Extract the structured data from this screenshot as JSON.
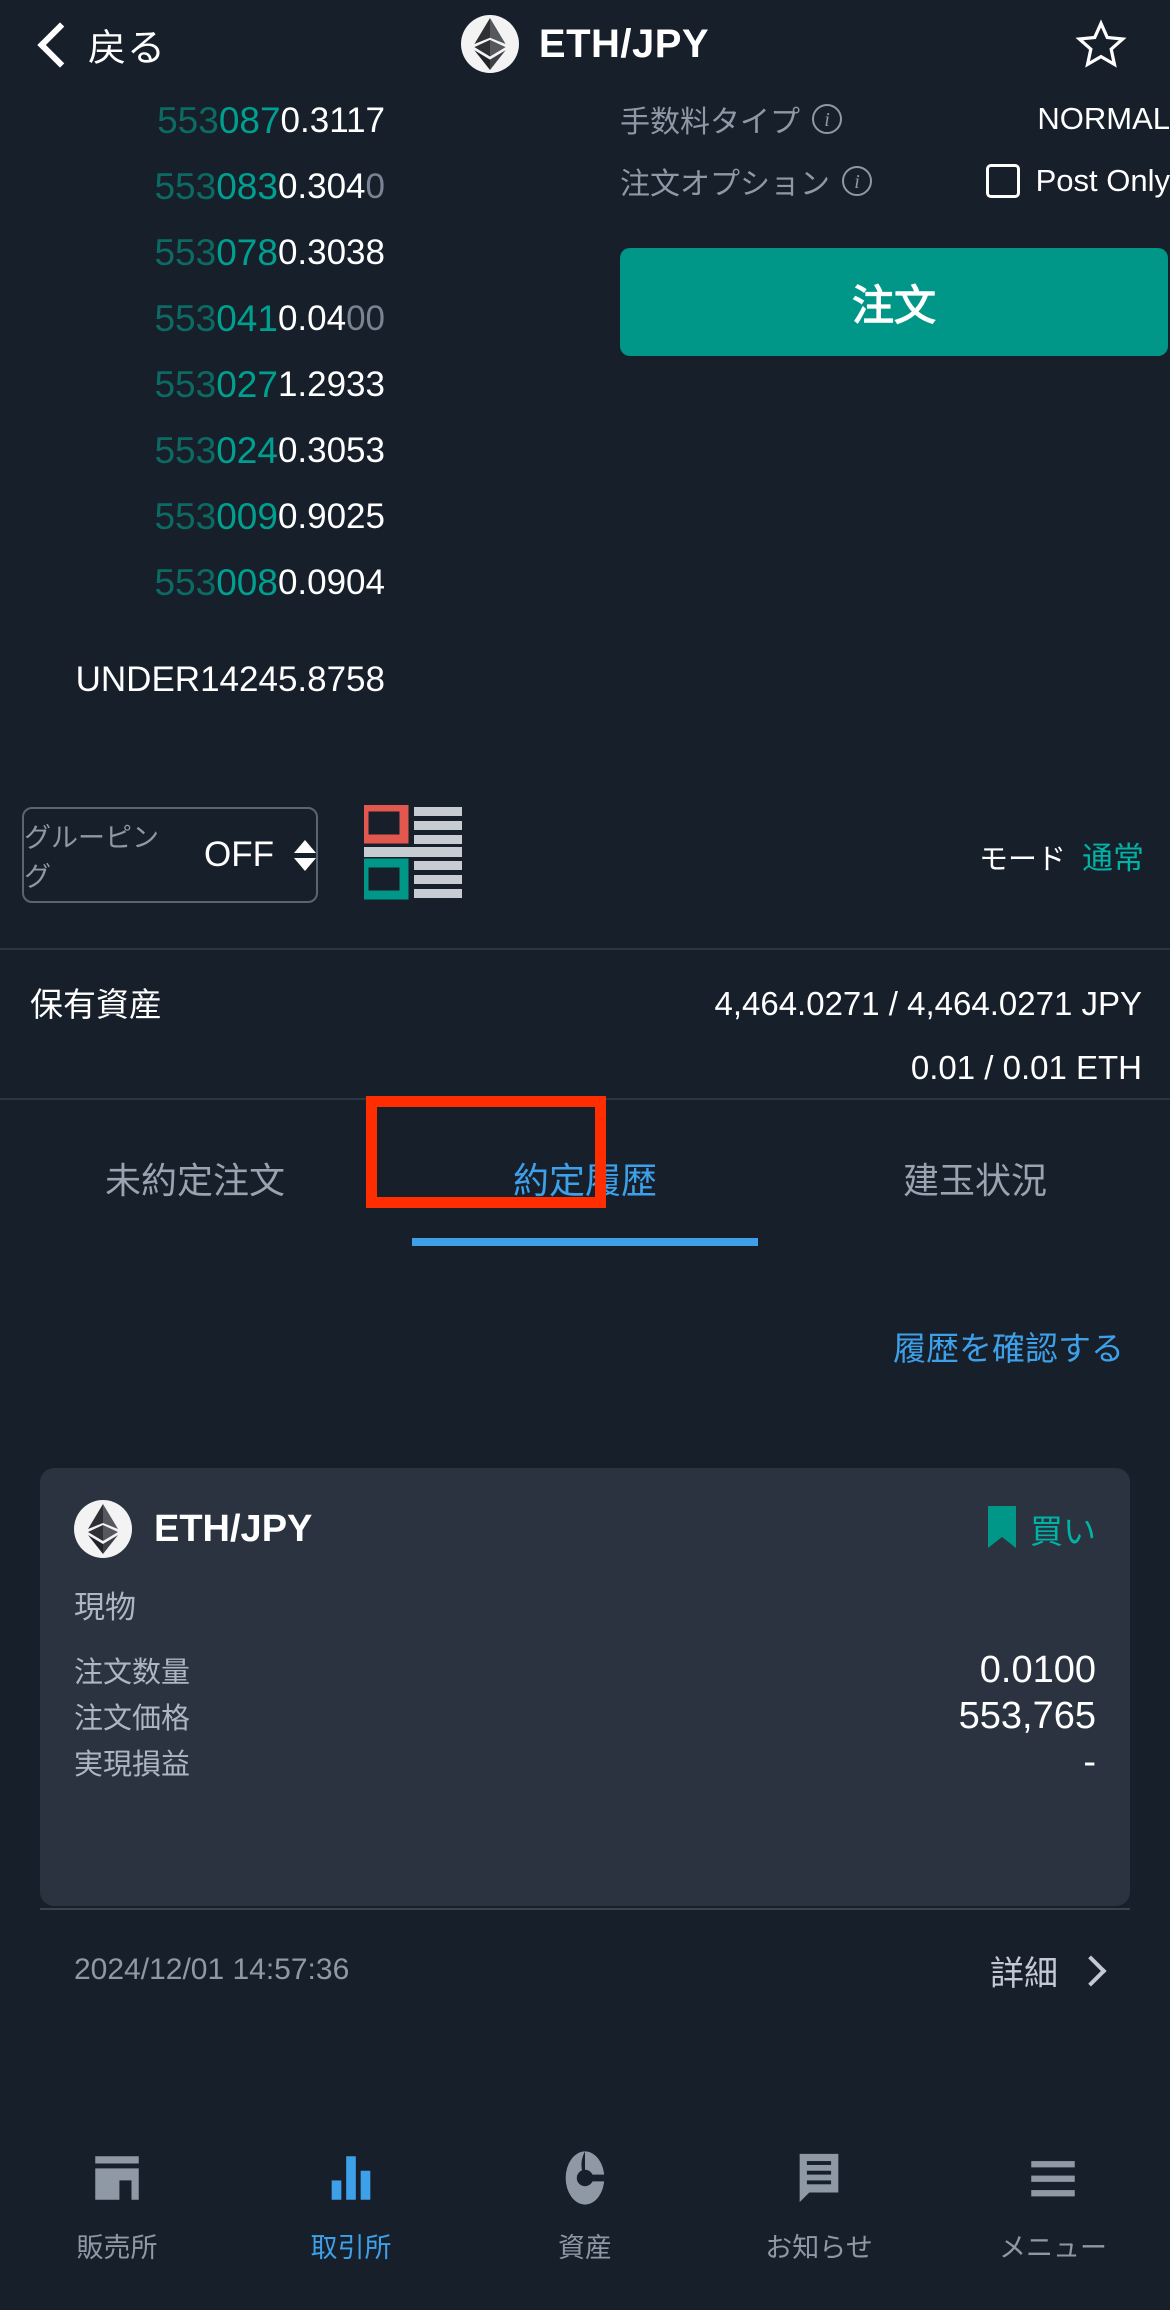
{
  "header": {
    "back_label": "戻る",
    "pair_title": "ETH/JPY",
    "back_icon": "chevron-left-icon",
    "star_icon": "star-outline-icon",
    "coin_icon": "ethereum-icon"
  },
  "orderbook": {
    "rows": [
      {
        "price_dim": "553",
        "price_bright": "087",
        "qty": "0.3117",
        "qty_faded": ""
      },
      {
        "price_dim": "553",
        "price_bright": "083",
        "qty": "0.304",
        "qty_faded": "0"
      },
      {
        "price_dim": "553",
        "price_bright": "078",
        "qty": "0.3038",
        "qty_faded": ""
      },
      {
        "price_dim": "553",
        "price_bright": "041",
        "qty": "0.04",
        "qty_faded": "00"
      },
      {
        "price_dim": "553",
        "price_bright": "027",
        "qty": "1.2933",
        "qty_faded": ""
      },
      {
        "price_dim": "553",
        "price_bright": "024",
        "qty": "0.3053",
        "qty_faded": ""
      },
      {
        "price_dim": "553",
        "price_bright": "009",
        "qty": "0.9025",
        "qty_faded": ""
      },
      {
        "price_dim": "553",
        "price_bright": "008",
        "qty": "0.0904",
        "qty_faded": ""
      }
    ],
    "under_label": "UNDER",
    "under_value": "14245.8758"
  },
  "order_panel": {
    "fee_type_label": "手数料タイプ",
    "fee_type_value": "NORMAL",
    "order_option_label": "注文オプション",
    "post_only_label": "Post Only",
    "post_only_checked": false,
    "submit_label": "注文"
  },
  "grouping": {
    "label": "グルーピング",
    "value": "OFF",
    "spinner_icon": "updown-arrows-icon",
    "depth_icon": "orderbook-layout-icon",
    "mode_label": "モード",
    "mode_value": "通常"
  },
  "assets": {
    "label": "保有資産",
    "lines": [
      "4,464.0271 / 4,464.0271  JPY",
      "0.01 / 0.01  ETH"
    ]
  },
  "tabs": {
    "items": [
      {
        "label": "未約定注文",
        "active": false
      },
      {
        "label": "約定履歴",
        "active": true
      },
      {
        "label": "建玉状況",
        "active": false
      }
    ],
    "highlight_color": "#ff2d00"
  },
  "history": {
    "link_label": "履歴を確認する",
    "card": {
      "pair": "ETH/JPY",
      "side_label": "買い",
      "side_icon": "bookmark-icon",
      "type_label": "現物",
      "rows": [
        {
          "label": "注文数量",
          "value": "0.0100"
        },
        {
          "label": "注文価格",
          "value": "553,765"
        },
        {
          "label": "実現損益",
          "value": "-"
        }
      ],
      "timestamp": "2024/12/01 14:57:36",
      "detail_label": "詳細",
      "detail_icon": "chevron-right-icon"
    }
  },
  "bottom_nav": {
    "items": [
      {
        "label": "販売所",
        "icon": "storefront-icon",
        "active": false
      },
      {
        "label": "取引所",
        "icon": "bar-chart-icon",
        "active": true
      },
      {
        "label": "資産",
        "icon": "pie-chart-icon",
        "active": false
      },
      {
        "label": "お知らせ",
        "icon": "notification-message-icon",
        "active": false
      },
      {
        "label": "メニュー",
        "icon": "hamburger-menu-icon",
        "active": false
      }
    ]
  },
  "colors": {
    "background": "#171f2b",
    "card": "#2b3240",
    "accent_teal": "#009688",
    "accent_blue": "#3da0e8",
    "bid_green": "#00a090",
    "bid_green_dim": "#0c6a63",
    "ask_red": "#e2584f",
    "highlight_red": "#ff2d00",
    "muted_text": "#8f98a5"
  }
}
